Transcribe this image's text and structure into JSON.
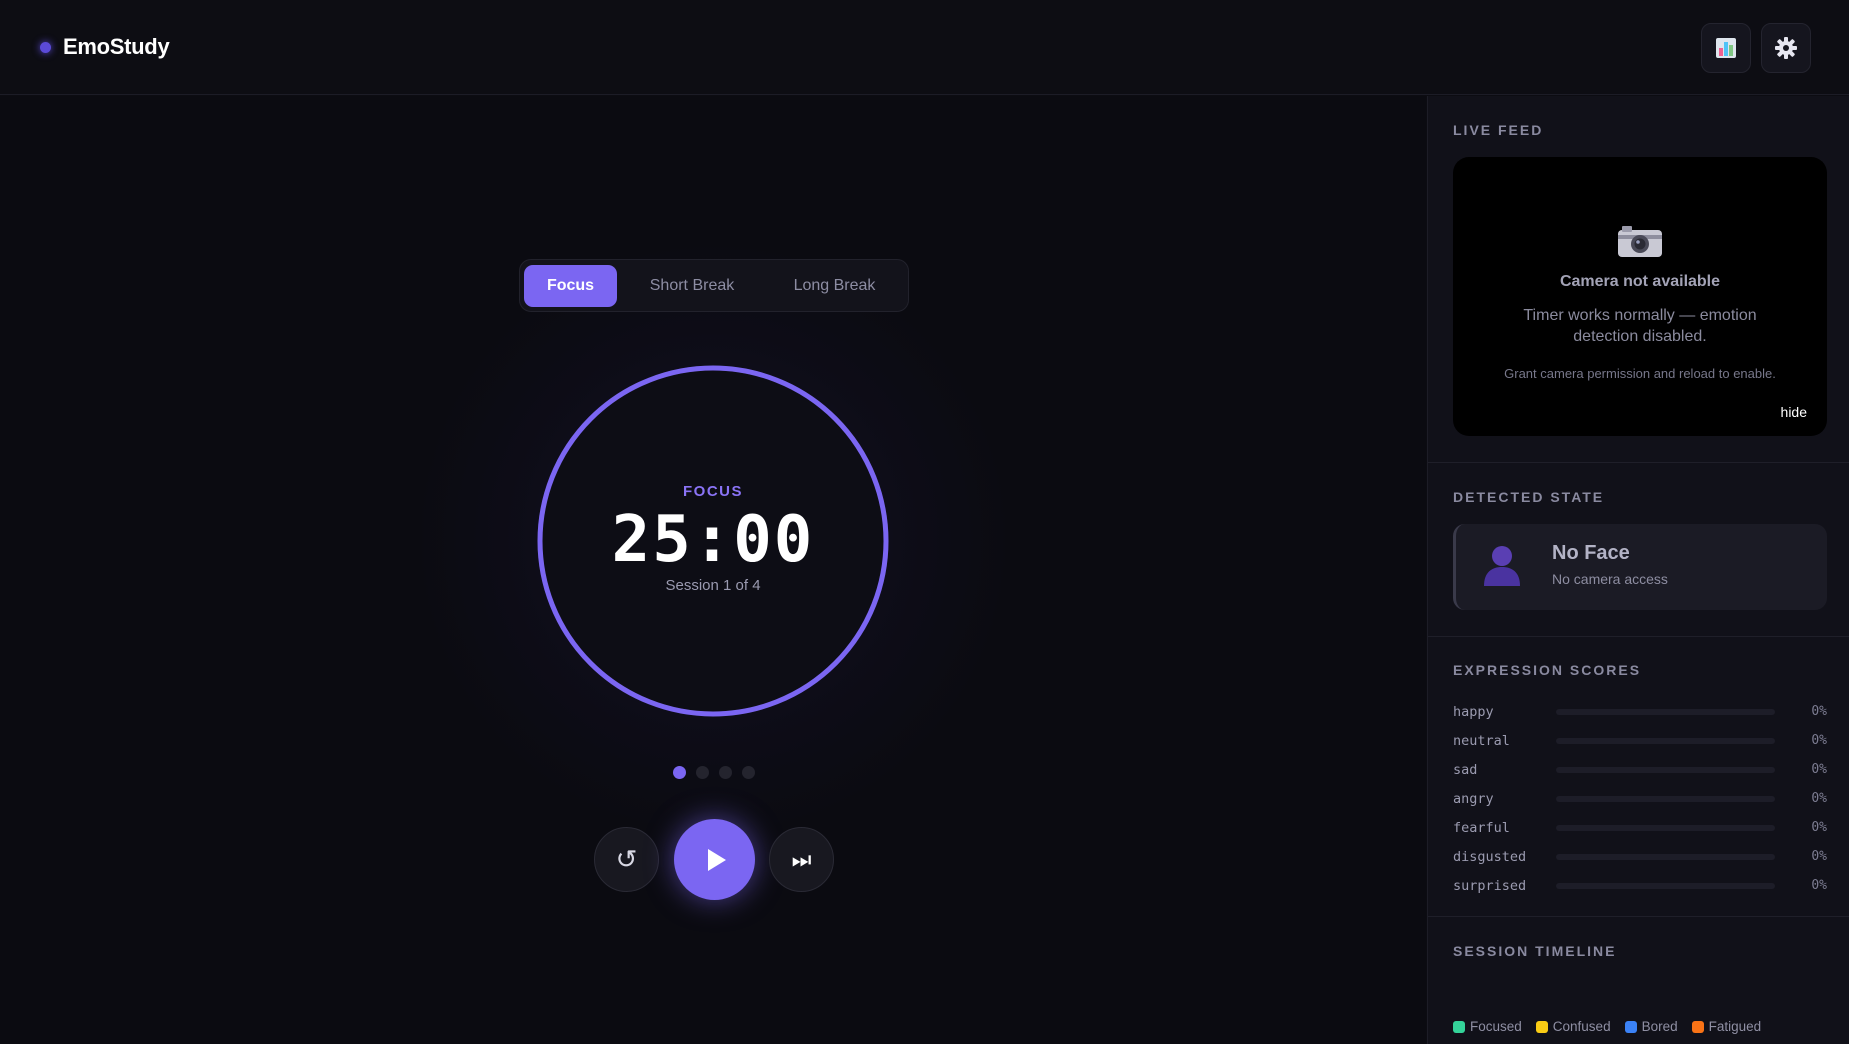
{
  "header": {
    "app_name": "EmoStudy",
    "stats_icon": "bar-chart-icon",
    "settings_icon": "gear-icon"
  },
  "timer": {
    "modes": [
      "Focus",
      "Short Break",
      "Long Break"
    ],
    "active_mode": "Focus",
    "label": "FOCUS",
    "time": "25:00",
    "session": "Session 1 of 4",
    "session_dots": {
      "total": 4,
      "current": 1
    },
    "progress": 1.0
  },
  "controls": {
    "reset_glyph": "↺",
    "skip_glyph": "⏭"
  },
  "sidebar": {
    "live_feed": {
      "title": "LIVE FEED",
      "camera_title": "Camera not available",
      "camera_message": "Timer works normally — emotion detection disabled.",
      "camera_hint": "Grant camera permission and reload to enable.",
      "hide_label": "hide"
    },
    "detected_state": {
      "title": "DETECTED STATE",
      "state": "No Face",
      "detail": "No camera access"
    },
    "expression_scores": {
      "title": "EXPRESSION SCORES",
      "items": [
        {
          "name": "happy",
          "value": "0%"
        },
        {
          "name": "neutral",
          "value": "0%"
        },
        {
          "name": "sad",
          "value": "0%"
        },
        {
          "name": "angry",
          "value": "0%"
        },
        {
          "name": "fearful",
          "value": "0%"
        },
        {
          "name": "disgusted",
          "value": "0%"
        },
        {
          "name": "surprised",
          "value": "0%"
        }
      ]
    },
    "session_timeline": {
      "title": "SESSION TIMELINE",
      "legend": [
        {
          "label": "Focused",
          "color": "#34d399"
        },
        {
          "label": "Confused",
          "color": "#facc15"
        },
        {
          "label": "Bored",
          "color": "#3b82f6"
        },
        {
          "label": "Fatigued",
          "color": "#f97316"
        }
      ]
    }
  },
  "colors": {
    "accent": "#7b66f2",
    "background": "#0b0b11",
    "panel": "#111119"
  }
}
